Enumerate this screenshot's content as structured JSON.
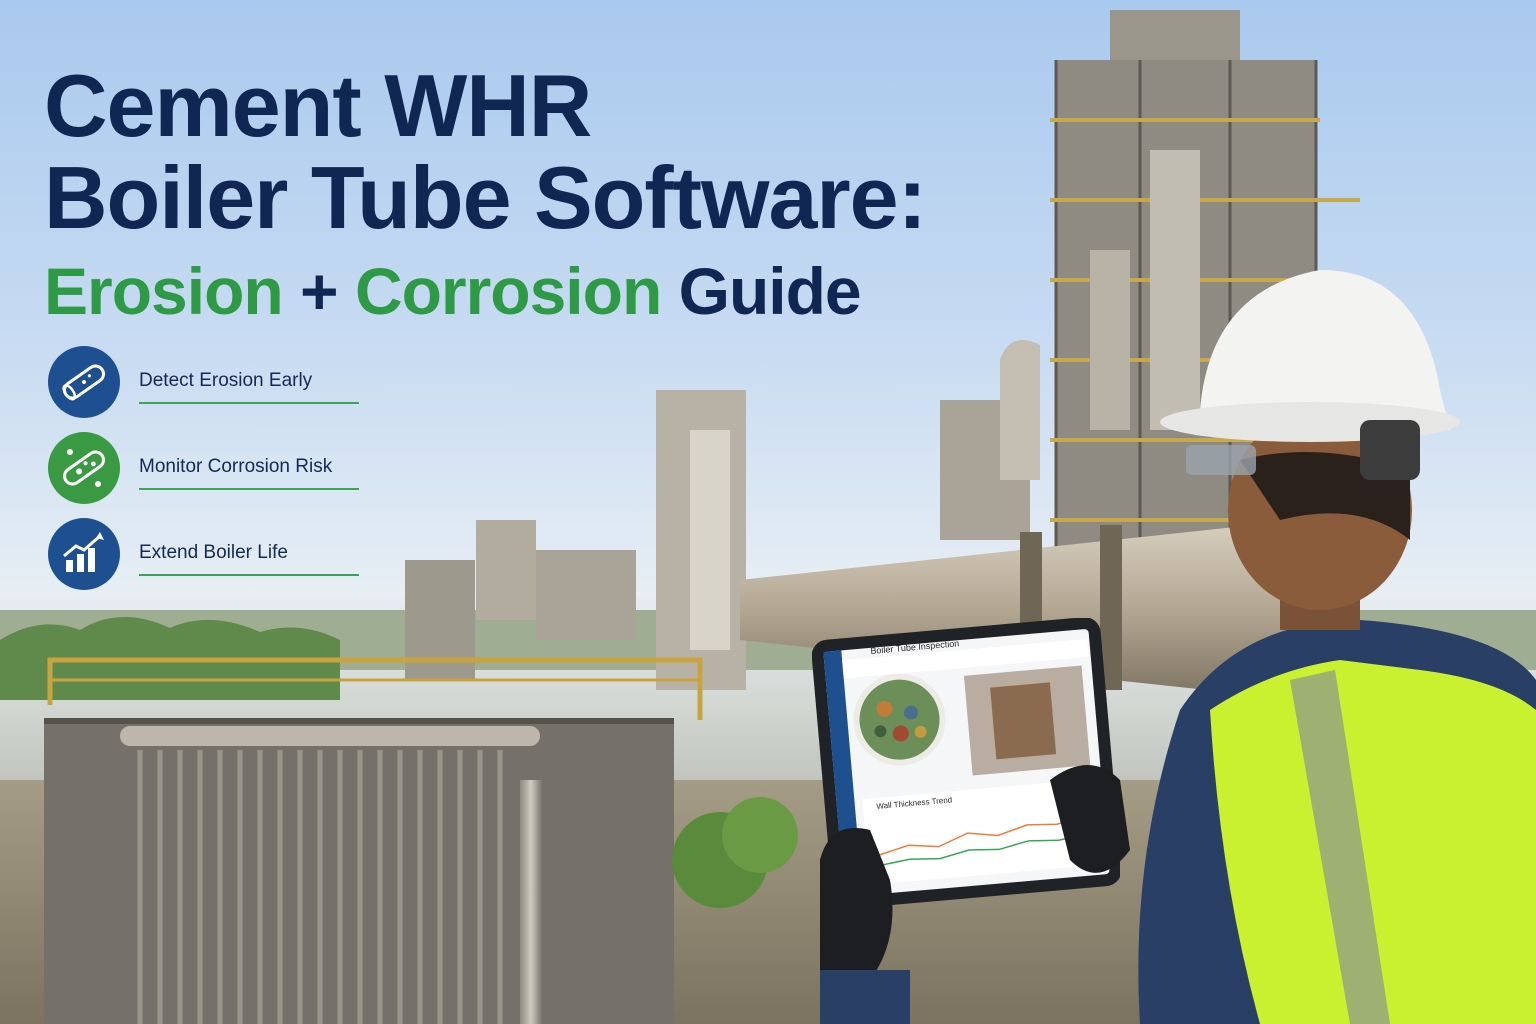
{
  "headline": {
    "line1": "Cement WHR",
    "line2": "Boiler Tube Software:",
    "line3_erosion": "Erosion",
    "line3_plus": "+",
    "line3_corrosion": "Corrosion",
    "line3_guide": "Guide"
  },
  "features": [
    {
      "label": "Detect Erosion Early",
      "icon": "pipe-icon",
      "color": "#1d4f91"
    },
    {
      "label": "Monitor Corrosion Risk",
      "icon": "corroded-pipe-icon",
      "color": "#3a9a44"
    },
    {
      "label": "Extend Boiler Life",
      "icon": "growth-chart-icon",
      "color": "#1d4f91"
    }
  ],
  "tablet": {
    "app_title": "Boiler Tube Inspection",
    "chart_title": "Wall Thickness Trend"
  },
  "colors": {
    "navy": "#0f2752",
    "green": "#2f9a45",
    "vest": "#c9f12f",
    "shirt": "#2a3f66"
  }
}
